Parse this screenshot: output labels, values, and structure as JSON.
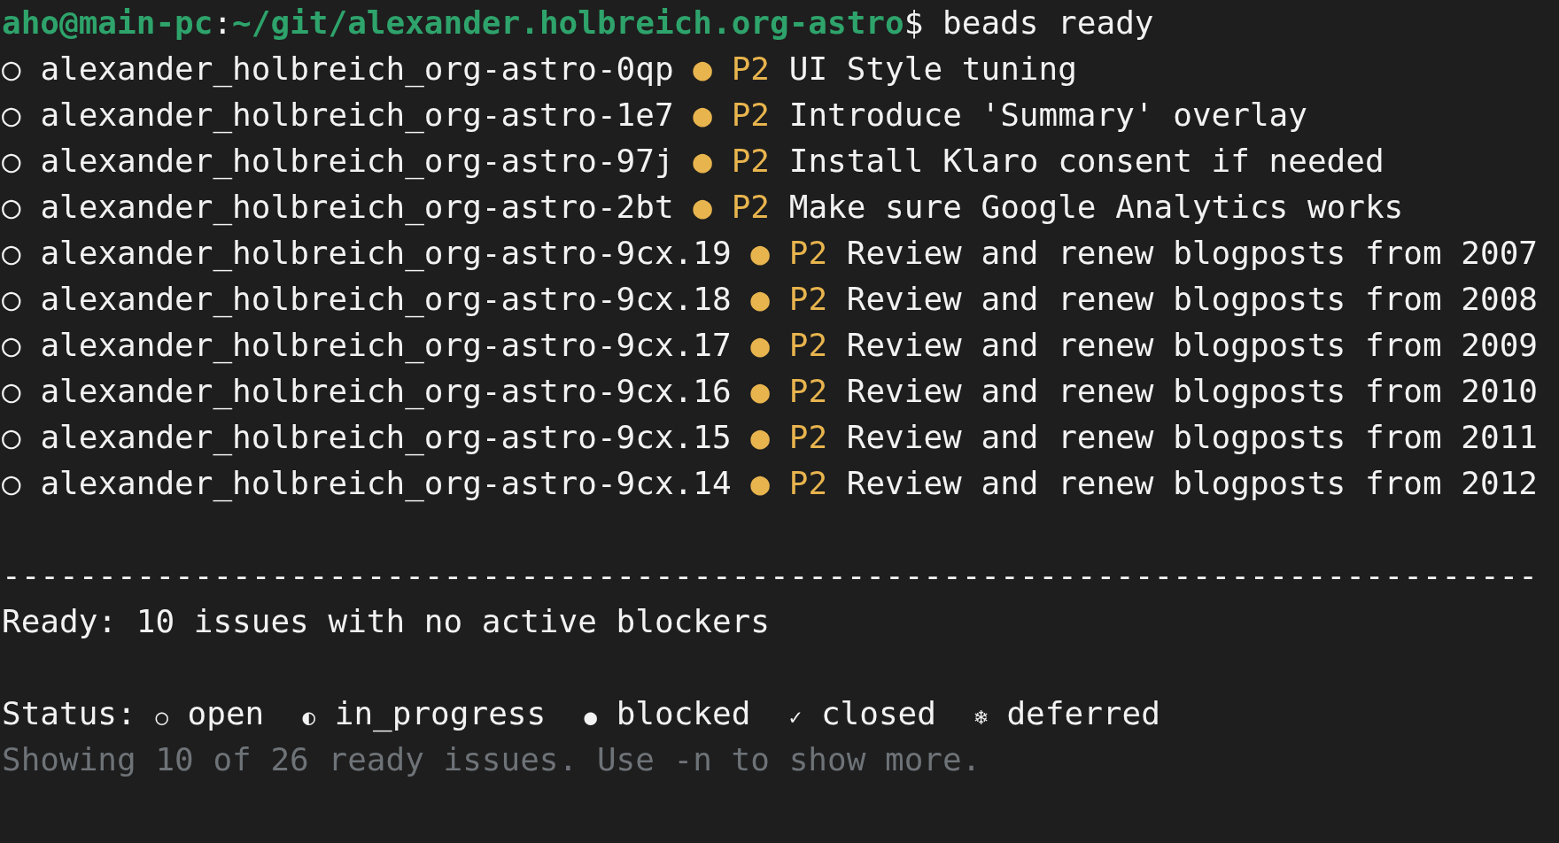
{
  "prompt": {
    "user_host": "aho@main-pc",
    "separator": ":",
    "path": "~/git/alexander.holbreich.org-astro",
    "symbol": "$",
    "command": "beads ready"
  },
  "issues": [
    {
      "status_symbol": "○",
      "id": "alexander_holbreich_org-astro-0qp",
      "priority_dot": "●",
      "priority": "P2",
      "title": "UI Style tuning"
    },
    {
      "status_symbol": "○",
      "id": "alexander_holbreich_org-astro-1e7",
      "priority_dot": "●",
      "priority": "P2",
      "title": "Introduce 'Summary' overlay"
    },
    {
      "status_symbol": "○",
      "id": "alexander_holbreich_org-astro-97j",
      "priority_dot": "●",
      "priority": "P2",
      "title": "Install Klaro consent if needed"
    },
    {
      "status_symbol": "○",
      "id": "alexander_holbreich_org-astro-2bt",
      "priority_dot": "●",
      "priority": "P2",
      "title": "Make sure Google Analytics works"
    },
    {
      "status_symbol": "○",
      "id": "alexander_holbreich_org-astro-9cx.19",
      "priority_dot": "●",
      "priority": "P2",
      "title": "Review and renew blogposts from 2007"
    },
    {
      "status_symbol": "○",
      "id": "alexander_holbreich_org-astro-9cx.18",
      "priority_dot": "●",
      "priority": "P2",
      "title": "Review and renew blogposts from 2008"
    },
    {
      "status_symbol": "○",
      "id": "alexander_holbreich_org-astro-9cx.17",
      "priority_dot": "●",
      "priority": "P2",
      "title": "Review and renew blogposts from 2009"
    },
    {
      "status_symbol": "○",
      "id": "alexander_holbreich_org-astro-9cx.16",
      "priority_dot": "●",
      "priority": "P2",
      "title": "Review and renew blogposts from 2010"
    },
    {
      "status_symbol": "○",
      "id": "alexander_holbreich_org-astro-9cx.15",
      "priority_dot": "●",
      "priority": "P2",
      "title": "Review and renew blogposts from 2011"
    },
    {
      "status_symbol": "○",
      "id": "alexander_holbreich_org-astro-9cx.14",
      "priority_dot": "●",
      "priority": "P2",
      "title": "Review and renew blogposts from 2012"
    }
  ],
  "separator_line": "--------------------------------------------------------------------------------",
  "summary": "Ready: 10 issues with no active blockers",
  "legend": {
    "label": "Status:",
    "items": [
      {
        "symbol": "○",
        "label": "open"
      },
      {
        "symbol": "◐",
        "label": "in_progress"
      },
      {
        "symbol": "●",
        "label": "blocked"
      },
      {
        "symbol": "✓",
        "label": "closed"
      },
      {
        "symbol": "❄",
        "label": "deferred"
      }
    ]
  },
  "hint": "Showing 10 of 26 ready issues. Use -n to show more."
}
